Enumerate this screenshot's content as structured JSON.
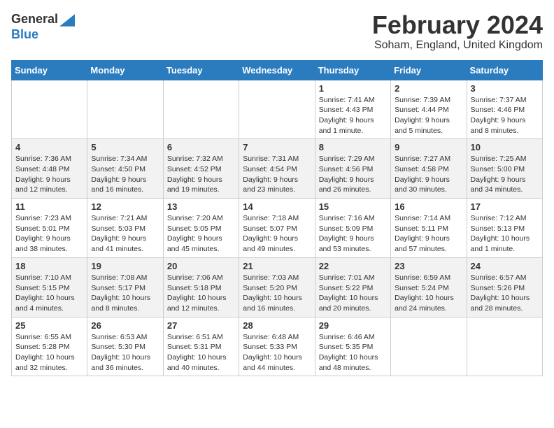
{
  "header": {
    "logo_general": "General",
    "logo_blue": "Blue",
    "month_title": "February 2024",
    "location": "Soham, England, United Kingdom"
  },
  "weekdays": [
    "Sunday",
    "Monday",
    "Tuesday",
    "Wednesday",
    "Thursday",
    "Friday",
    "Saturday"
  ],
  "weeks": [
    [
      {
        "day": "",
        "info": ""
      },
      {
        "day": "",
        "info": ""
      },
      {
        "day": "",
        "info": ""
      },
      {
        "day": "",
        "info": ""
      },
      {
        "day": "1",
        "info": "Sunrise: 7:41 AM\nSunset: 4:43 PM\nDaylight: 9 hours and 1 minute."
      },
      {
        "day": "2",
        "info": "Sunrise: 7:39 AM\nSunset: 4:44 PM\nDaylight: 9 hours and 5 minutes."
      },
      {
        "day": "3",
        "info": "Sunrise: 7:37 AM\nSunset: 4:46 PM\nDaylight: 9 hours and 8 minutes."
      }
    ],
    [
      {
        "day": "4",
        "info": "Sunrise: 7:36 AM\nSunset: 4:48 PM\nDaylight: 9 hours and 12 minutes."
      },
      {
        "day": "5",
        "info": "Sunrise: 7:34 AM\nSunset: 4:50 PM\nDaylight: 9 hours and 16 minutes."
      },
      {
        "day": "6",
        "info": "Sunrise: 7:32 AM\nSunset: 4:52 PM\nDaylight: 9 hours and 19 minutes."
      },
      {
        "day": "7",
        "info": "Sunrise: 7:31 AM\nSunset: 4:54 PM\nDaylight: 9 hours and 23 minutes."
      },
      {
        "day": "8",
        "info": "Sunrise: 7:29 AM\nSunset: 4:56 PM\nDaylight: 9 hours and 26 minutes."
      },
      {
        "day": "9",
        "info": "Sunrise: 7:27 AM\nSunset: 4:58 PM\nDaylight: 9 hours and 30 minutes."
      },
      {
        "day": "10",
        "info": "Sunrise: 7:25 AM\nSunset: 5:00 PM\nDaylight: 9 hours and 34 minutes."
      }
    ],
    [
      {
        "day": "11",
        "info": "Sunrise: 7:23 AM\nSunset: 5:01 PM\nDaylight: 9 hours and 38 minutes."
      },
      {
        "day": "12",
        "info": "Sunrise: 7:21 AM\nSunset: 5:03 PM\nDaylight: 9 hours and 41 minutes."
      },
      {
        "day": "13",
        "info": "Sunrise: 7:20 AM\nSunset: 5:05 PM\nDaylight: 9 hours and 45 minutes."
      },
      {
        "day": "14",
        "info": "Sunrise: 7:18 AM\nSunset: 5:07 PM\nDaylight: 9 hours and 49 minutes."
      },
      {
        "day": "15",
        "info": "Sunrise: 7:16 AM\nSunset: 5:09 PM\nDaylight: 9 hours and 53 minutes."
      },
      {
        "day": "16",
        "info": "Sunrise: 7:14 AM\nSunset: 5:11 PM\nDaylight: 9 hours and 57 minutes."
      },
      {
        "day": "17",
        "info": "Sunrise: 7:12 AM\nSunset: 5:13 PM\nDaylight: 10 hours and 1 minute."
      }
    ],
    [
      {
        "day": "18",
        "info": "Sunrise: 7:10 AM\nSunset: 5:15 PM\nDaylight: 10 hours and 4 minutes."
      },
      {
        "day": "19",
        "info": "Sunrise: 7:08 AM\nSunset: 5:17 PM\nDaylight: 10 hours and 8 minutes."
      },
      {
        "day": "20",
        "info": "Sunrise: 7:06 AM\nSunset: 5:18 PM\nDaylight: 10 hours and 12 minutes."
      },
      {
        "day": "21",
        "info": "Sunrise: 7:03 AM\nSunset: 5:20 PM\nDaylight: 10 hours and 16 minutes."
      },
      {
        "day": "22",
        "info": "Sunrise: 7:01 AM\nSunset: 5:22 PM\nDaylight: 10 hours and 20 minutes."
      },
      {
        "day": "23",
        "info": "Sunrise: 6:59 AM\nSunset: 5:24 PM\nDaylight: 10 hours and 24 minutes."
      },
      {
        "day": "24",
        "info": "Sunrise: 6:57 AM\nSunset: 5:26 PM\nDaylight: 10 hours and 28 minutes."
      }
    ],
    [
      {
        "day": "25",
        "info": "Sunrise: 6:55 AM\nSunset: 5:28 PM\nDaylight: 10 hours and 32 minutes."
      },
      {
        "day": "26",
        "info": "Sunrise: 6:53 AM\nSunset: 5:30 PM\nDaylight: 10 hours and 36 minutes."
      },
      {
        "day": "27",
        "info": "Sunrise: 6:51 AM\nSunset: 5:31 PM\nDaylight: 10 hours and 40 minutes."
      },
      {
        "day": "28",
        "info": "Sunrise: 6:48 AM\nSunset: 5:33 PM\nDaylight: 10 hours and 44 minutes."
      },
      {
        "day": "29",
        "info": "Sunrise: 6:46 AM\nSunset: 5:35 PM\nDaylight: 10 hours and 48 minutes."
      },
      {
        "day": "",
        "info": ""
      },
      {
        "day": "",
        "info": ""
      }
    ]
  ]
}
